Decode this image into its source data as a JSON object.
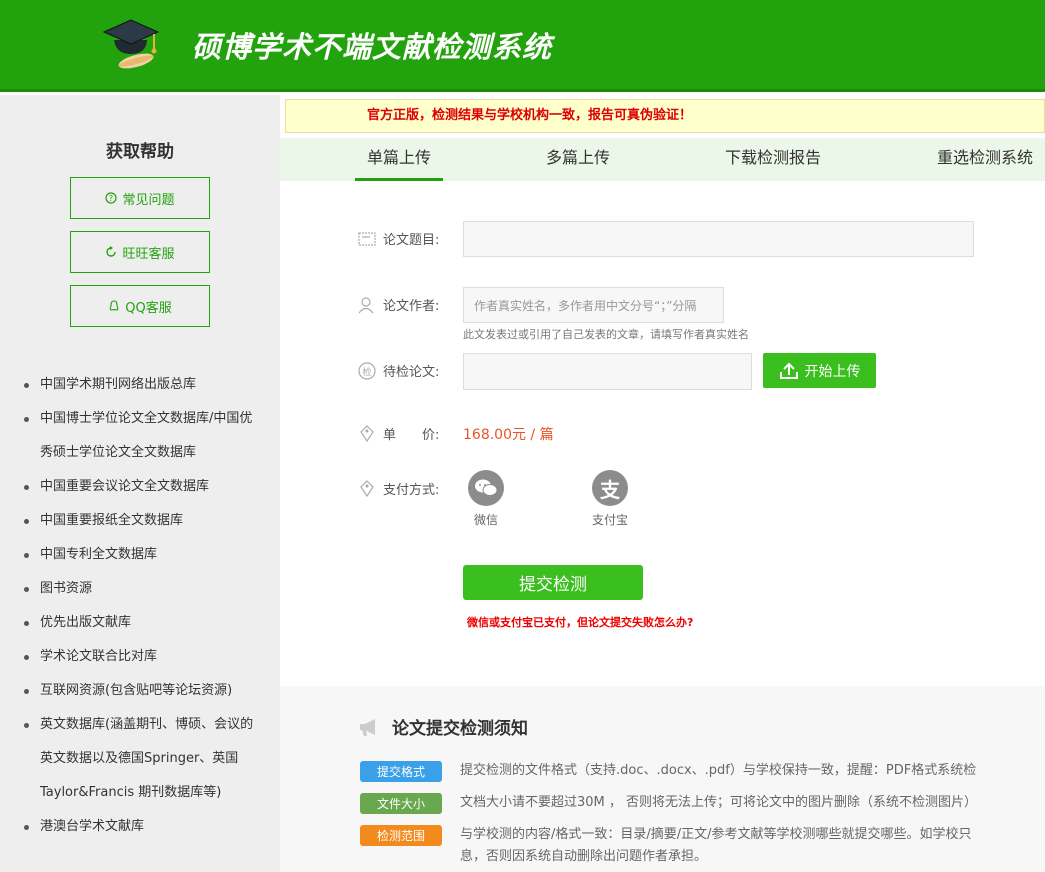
{
  "header": {
    "title": "硕博学术不端文献检测系统"
  },
  "sidebar": {
    "help_title": "获取帮助",
    "help_buttons": [
      "常见问题",
      "旺旺客服",
      "QQ客服"
    ],
    "databases": [
      "中国学术期刊网络出版总库",
      "中国博士学位论文全文数据库/中国优秀硕士学位论文全文数据库",
      "中国重要会议论文全文数据库",
      "中国重要报纸全文数据库",
      "中国专利全文数据库",
      "图书资源",
      "优先出版文献库",
      "学术论文联合比对库",
      "互联网资源(包含贴吧等论坛资源)",
      "英文数据库(涵盖期刊、博硕、会议的英文数据以及德国Springer、英国Taylor&Francis 期刊数据库等)",
      "港澳台学术文献库"
    ]
  },
  "notice": "官方正版，检测结果与学校机构一致，报告可真伪验证！",
  "tabs": [
    "单篇上传",
    "多篇上传",
    "下载检测报告",
    "重选检测系统"
  ],
  "form": {
    "title_label": "论文题目:",
    "title_value": "",
    "author_label": "论文作者:",
    "author_placeholder": "作者真实姓名，多作者用中文分号“；”分隔",
    "author_hint": "此文发表过或引用了自己发表的文章，请填写作者真实姓名",
    "file_label": "待检论文:",
    "upload_label": "开始上传",
    "price_label": "单　　价:",
    "price_value": "168.00元 / 篇",
    "payment_label": "支付方式:",
    "payment_options": [
      "微信",
      "支付宝"
    ],
    "submit_label": "提交检测",
    "pay_fail_link": "微信或支付宝已支付，但论文提交失败怎么办?"
  },
  "notes": {
    "title": "论文提交检测须知",
    "items": [
      {
        "badge": "提交格式",
        "color": "#3aa0e8",
        "text": "提交检测的文件格式（支持.doc、.docx、.pdf）与学校保持一致，提醒：PDF格式系统检"
      },
      {
        "badge": "文件大小",
        "color": "#6aa84f",
        "text": "文档大小请不要超过30M ， 否则将无法上传；可将论文中的图片删除（系统不检测图片）"
      },
      {
        "badge": "检测范围",
        "color": "#f28a1e",
        "text": "与学校测的内容/格式一致：目录/摘要/正文/参考文献等学校测哪些就提交哪些。如学校只",
        "text2": "息，否则因系统自动删除出问题作者承担。"
      }
    ]
  },
  "colors": {
    "brand_green": "#22a20c",
    "button_green": "#3bbf1f",
    "price_orange": "#e8542a",
    "alert_red": "#dd0000"
  }
}
